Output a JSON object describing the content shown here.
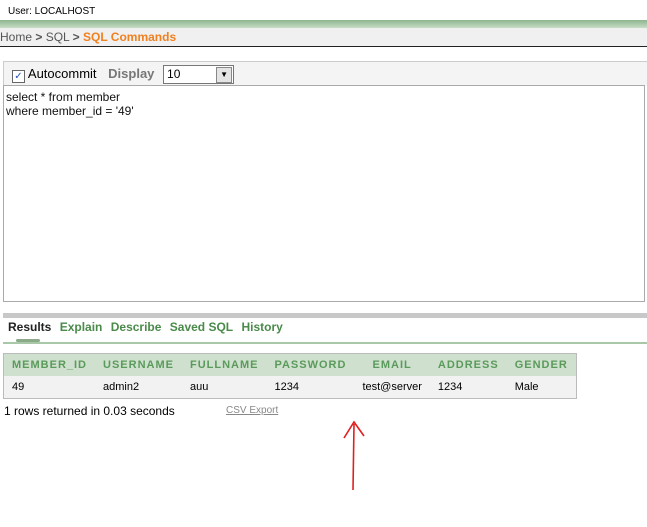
{
  "header": {
    "user": "User: LOCALHOST"
  },
  "breadcrumb": {
    "items": [
      "Home",
      "SQL"
    ],
    "separator": ">",
    "current": "SQL Commands"
  },
  "toolbar": {
    "autocommit_label": "Autocommit",
    "autocommit_checked": true,
    "display_label": "Display",
    "display_value": "10"
  },
  "editor": {
    "value": "select * from member\nwhere member_id = '49'"
  },
  "tabs": [
    {
      "label": "Results",
      "active": true
    },
    {
      "label": "Explain"
    },
    {
      "label": "Describe"
    },
    {
      "label": "Saved SQL"
    },
    {
      "label": "History"
    }
  ],
  "results": {
    "columns": [
      "MEMBER_ID",
      "USERNAME",
      "FULLNAME",
      "PASSWORD",
      "EMAIL",
      "ADDRESS",
      "GENDER"
    ],
    "rows": [
      [
        "49",
        "admin2",
        "auu",
        "1234",
        "test@server",
        "1234",
        "Male"
      ]
    ],
    "summary": "1 rows returned in 0.03 seconds",
    "csv_export": "CSV Export"
  },
  "colors": {
    "accent": "#f08020",
    "tab_green": "#4a8a4a",
    "annotation_arrow": "#e02020"
  }
}
